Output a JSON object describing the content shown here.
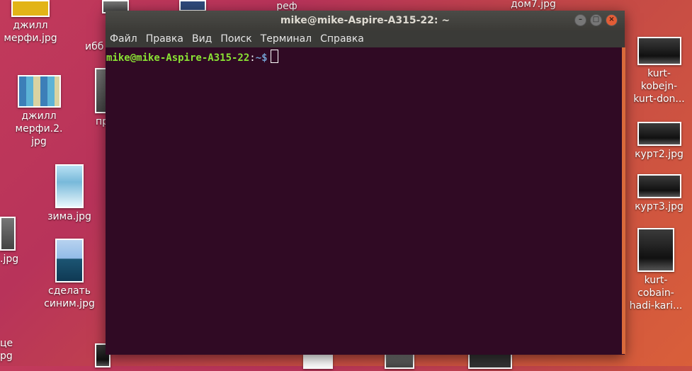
{
  "desktop": {
    "left": [
      {
        "label": "джилл\nмерфи.jpg"
      },
      {
        "label": "джилл\nмерфи.2.\njpg"
      },
      {
        "label": "зима.jpg"
      },
      {
        "label": "сделать\nсиним.jpg"
      },
      {
        "label": ".jpg"
      },
      {
        "label": "це\npg"
      }
    ],
    "partial": [
      {
        "label": "ибб"
      },
      {
        "label": "пр"
      }
    ],
    "top": [
      {
        "label": "реф"
      },
      {
        "label": "дом7.jpg"
      }
    ],
    "right": [
      {
        "label": "kurt-\nkobejn-\nkurt-don..."
      },
      {
        "label": "курт2.jpg"
      },
      {
        "label": "курт3.jpg"
      },
      {
        "label": "kurt-\ncobain-\nhadi-kari..."
      }
    ]
  },
  "terminal": {
    "title": "mike@mike-Aspire-A315-22: ~",
    "menu": [
      "Файл",
      "Правка",
      "Вид",
      "Поиск",
      "Терминал",
      "Справка"
    ],
    "prompt_user": "mike@mike-Aspire-A315-22",
    "prompt_sep": ":",
    "prompt_path": "~$"
  }
}
